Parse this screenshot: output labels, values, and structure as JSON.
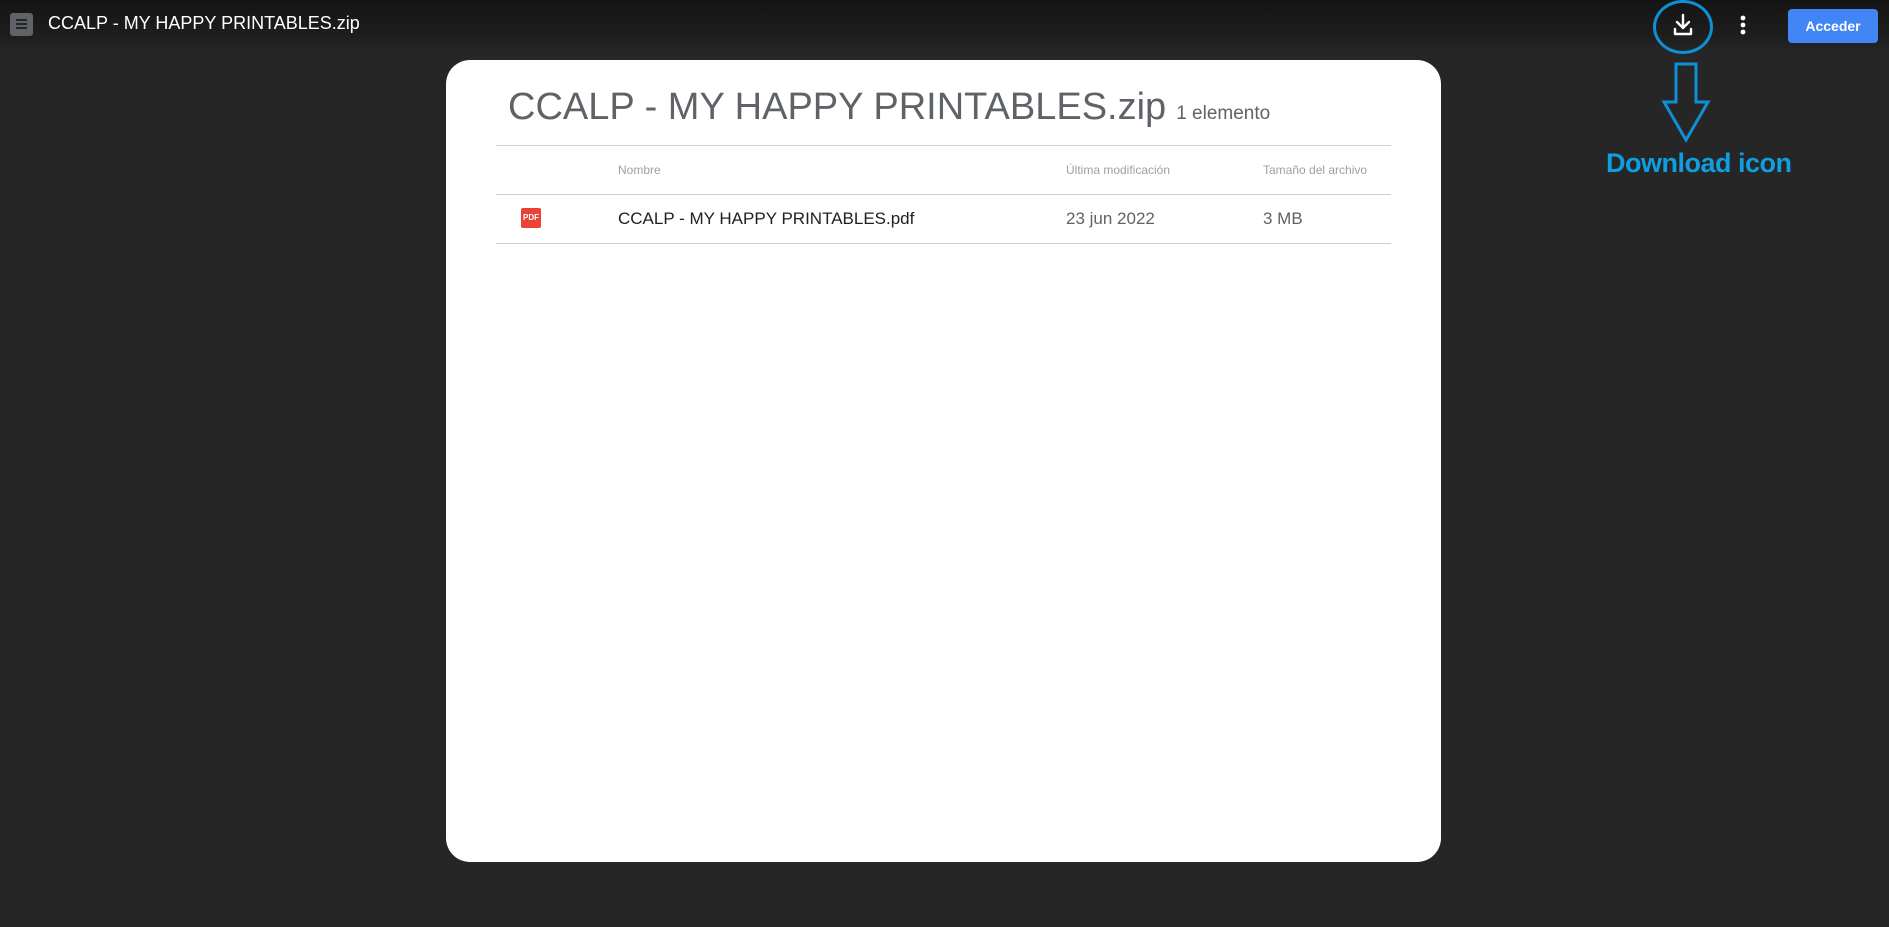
{
  "topbar": {
    "app_icon": "drive-file-icon",
    "title": "CCALP - MY HAPPY PRINTABLES.zip",
    "download_icon": "download-icon",
    "more_icon": "more-vert-icon",
    "signin_label": "Acceder",
    "signin_color": "#4285f4"
  },
  "annotation": {
    "text": "Download icon",
    "color": "#0f9ee0"
  },
  "card": {
    "title": "CCALP - MY HAPPY PRINTABLES.zip",
    "item_count": "1 elemento",
    "columns": {
      "name": "Nombre",
      "modified": "Última modificación",
      "size": "Tamaño del archivo"
    },
    "files": [
      {
        "icon": "pdf-icon",
        "icon_label": "PDF",
        "name": "CCALP - MY HAPPY PRINTABLES.pdf",
        "modified": "23 jun 2022",
        "size": "3 MB"
      }
    ]
  }
}
